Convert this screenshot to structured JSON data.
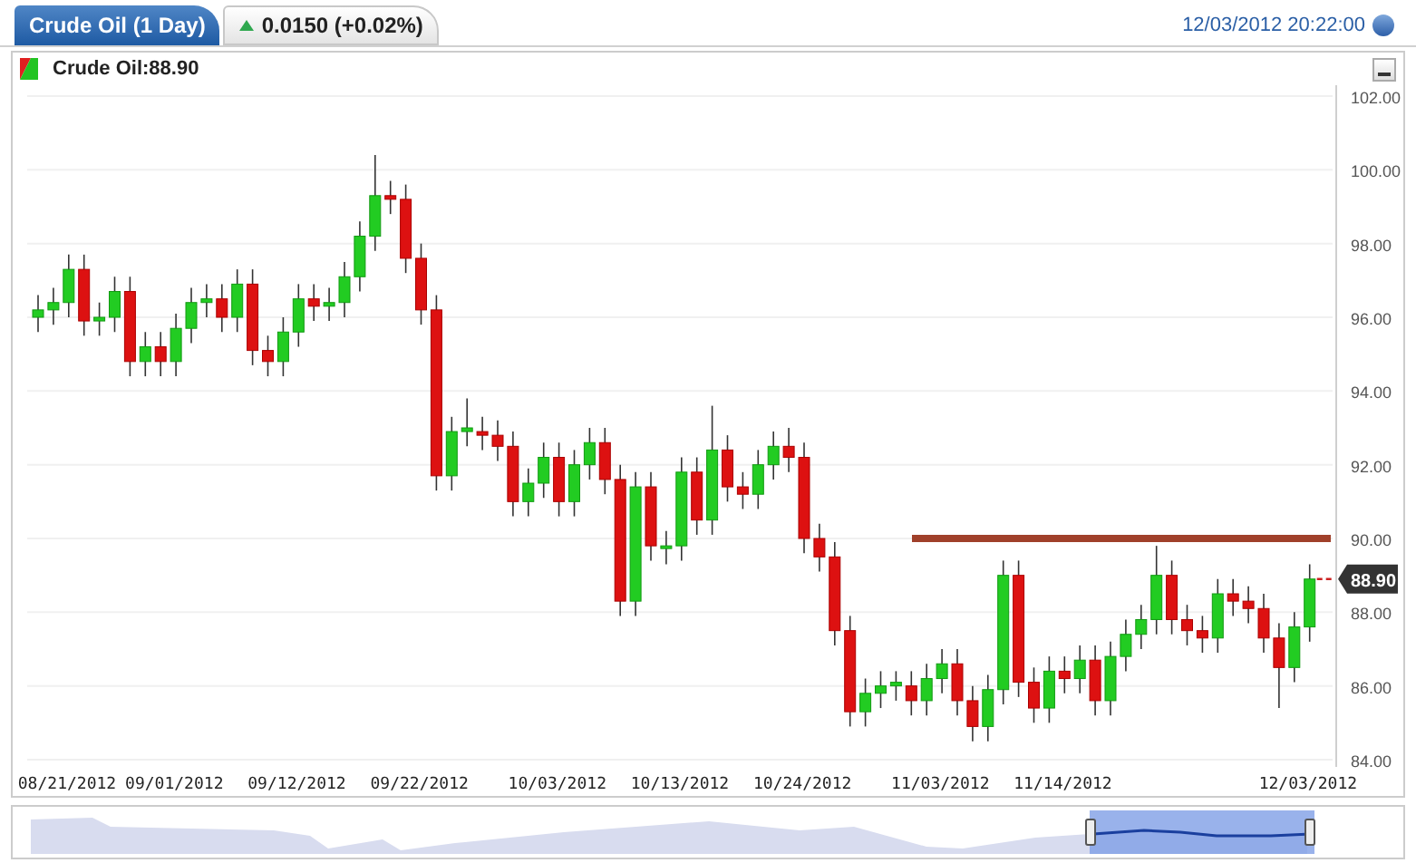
{
  "header": {
    "tabs": [
      {
        "label": "Crude Oil (1 Day)",
        "selected": true
      },
      {
        "label": "0.0150 (+0.02%)",
        "selected": false,
        "kind": "up"
      }
    ],
    "timestamp": "12/03/2012 20:22:00"
  },
  "chart": {
    "legend": "Crude Oil:88.90",
    "last_price_label": "88.90",
    "chart_data": {
      "type": "candlestick",
      "ylim": [
        84,
        102
      ],
      "categories": [
        null,
        null,
        "08/21/2012",
        null,
        null,
        null,
        null,
        null,
        null,
        "09/01/2012",
        null,
        null,
        null,
        null,
        null,
        null,
        null,
        "09/12/2012",
        null,
        null,
        null,
        null,
        null,
        null,
        null,
        "09/22/2012",
        null,
        null,
        null,
        null,
        null,
        null,
        null,
        null,
        "10/03/2012",
        null,
        null,
        null,
        null,
        null,
        null,
        null,
        "10/13/2012",
        null,
        null,
        null,
        null,
        null,
        null,
        null,
        "10/24/2012",
        null,
        null,
        null,
        null,
        null,
        null,
        null,
        null,
        "11/03/2012",
        null,
        null,
        null,
        null,
        null,
        null,
        null,
        "11/14/2012",
        null,
        null,
        null,
        null,
        null,
        null,
        null,
        null,
        null,
        null,
        null,
        null,
        null,
        null,
        null,
        "12/03/2012"
      ],
      "yticks": [
        {
          "value": 84,
          "label": "84.00"
        },
        {
          "value": 86,
          "label": "86.00"
        },
        {
          "value": 88,
          "label": "88.00"
        },
        {
          "value": 90,
          "label": "90.00"
        },
        {
          "value": 92,
          "label": "92.00"
        },
        {
          "value": 94,
          "label": "94.00"
        },
        {
          "value": 96,
          "label": "96.00"
        },
        {
          "value": 98,
          "label": "98.00"
        },
        {
          "value": 100,
          "label": "100.00"
        },
        {
          "value": 102,
          "label": "102.00"
        }
      ],
      "ohlc": [
        [
          96.0,
          96.6,
          95.6,
          96.2
        ],
        [
          96.2,
          96.8,
          95.8,
          96.4
        ],
        [
          96.4,
          97.7,
          96.0,
          97.3
        ],
        [
          97.3,
          97.7,
          95.5,
          95.9
        ],
        [
          95.9,
          96.4,
          95.5,
          96.0
        ],
        [
          96.0,
          97.1,
          95.6,
          96.7
        ],
        [
          96.7,
          97.1,
          94.4,
          94.8
        ],
        [
          94.8,
          95.6,
          94.4,
          95.2
        ],
        [
          95.2,
          95.6,
          94.4,
          94.8
        ],
        [
          94.8,
          96.1,
          94.4,
          95.7
        ],
        [
          95.7,
          96.8,
          95.3,
          96.4
        ],
        [
          96.4,
          96.9,
          96.0,
          96.5
        ],
        [
          96.5,
          96.9,
          95.6,
          96.0
        ],
        [
          96.0,
          97.3,
          95.6,
          96.9
        ],
        [
          96.9,
          97.3,
          94.7,
          95.1
        ],
        [
          95.1,
          95.5,
          94.4,
          94.8
        ],
        [
          94.8,
          96.0,
          94.4,
          95.6
        ],
        [
          95.6,
          96.9,
          95.2,
          96.5
        ],
        [
          96.5,
          96.9,
          95.9,
          96.3
        ],
        [
          96.3,
          96.8,
          95.9,
          96.4
        ],
        [
          96.4,
          97.5,
          96.0,
          97.1
        ],
        [
          97.1,
          98.6,
          96.7,
          98.2
        ],
        [
          98.2,
          100.4,
          97.8,
          99.3
        ],
        [
          99.3,
          99.7,
          98.8,
          99.2
        ],
        [
          99.2,
          99.6,
          97.2,
          97.6
        ],
        [
          97.6,
          98.0,
          95.8,
          96.2
        ],
        [
          96.2,
          96.6,
          91.3,
          91.7
        ],
        [
          91.7,
          93.3,
          91.3,
          92.9
        ],
        [
          92.9,
          93.8,
          92.5,
          93.0
        ],
        [
          92.9,
          93.3,
          92.4,
          92.8
        ],
        [
          92.8,
          93.2,
          92.1,
          92.5
        ],
        [
          92.5,
          92.9,
          90.6,
          91.0
        ],
        [
          91.0,
          91.9,
          90.6,
          91.5
        ],
        [
          91.5,
          92.6,
          91.1,
          92.2
        ],
        [
          92.2,
          92.6,
          90.6,
          91.0
        ],
        [
          91.0,
          92.4,
          90.6,
          92.0
        ],
        [
          92.0,
          93.0,
          91.6,
          92.6
        ],
        [
          92.6,
          93.0,
          91.2,
          91.6
        ],
        [
          91.6,
          92.0,
          87.9,
          88.3
        ],
        [
          88.3,
          91.8,
          87.9,
          91.4
        ],
        [
          91.4,
          91.8,
          89.4,
          89.8
        ],
        [
          89.8,
          90.2,
          89.3,
          89.8
        ],
        [
          89.8,
          92.2,
          89.4,
          91.8
        ],
        [
          91.8,
          92.2,
          90.1,
          90.5
        ],
        [
          90.5,
          93.6,
          90.1,
          92.4
        ],
        [
          92.4,
          92.8,
          91.0,
          91.4
        ],
        [
          91.4,
          91.8,
          90.8,
          91.2
        ],
        [
          91.2,
          92.4,
          90.8,
          92.0
        ],
        [
          92.0,
          92.9,
          91.6,
          92.5
        ],
        [
          92.5,
          93.0,
          91.8,
          92.2
        ],
        [
          92.2,
          92.6,
          89.6,
          90.0
        ],
        [
          90.0,
          90.4,
          89.1,
          89.5
        ],
        [
          89.5,
          89.9,
          87.1,
          87.5
        ],
        [
          87.5,
          87.9,
          84.9,
          85.3
        ],
        [
          85.3,
          86.2,
          84.9,
          85.8
        ],
        [
          85.8,
          86.4,
          85.4,
          86.0
        ],
        [
          86.0,
          86.4,
          85.6,
          86.1
        ],
        [
          86.0,
          86.4,
          85.2,
          85.6
        ],
        [
          85.6,
          86.6,
          85.2,
          86.2
        ],
        [
          86.2,
          87.0,
          85.8,
          86.6
        ],
        [
          86.6,
          87.0,
          85.2,
          85.6
        ],
        [
          85.6,
          86.0,
          84.5,
          84.9
        ],
        [
          84.9,
          86.3,
          84.5,
          85.9
        ],
        [
          85.9,
          89.4,
          85.5,
          89.0
        ],
        [
          89.0,
          89.4,
          85.7,
          86.1
        ],
        [
          86.1,
          86.5,
          85.0,
          85.4
        ],
        [
          85.4,
          86.8,
          85.0,
          86.4
        ],
        [
          86.4,
          86.8,
          85.8,
          86.2
        ],
        [
          86.2,
          87.1,
          85.8,
          86.7
        ],
        [
          86.7,
          87.1,
          85.2,
          85.6
        ],
        [
          85.6,
          87.2,
          85.2,
          86.8
        ],
        [
          86.8,
          87.8,
          86.4,
          87.4
        ],
        [
          87.4,
          88.2,
          87.0,
          87.8
        ],
        [
          87.8,
          89.8,
          87.4,
          89.0
        ],
        [
          89.0,
          89.4,
          87.4,
          87.8
        ],
        [
          87.8,
          88.2,
          87.1,
          87.5
        ],
        [
          87.5,
          87.9,
          86.9,
          87.3
        ],
        [
          87.3,
          88.9,
          86.9,
          88.5
        ],
        [
          88.5,
          88.9,
          87.9,
          88.3
        ],
        [
          88.3,
          88.7,
          87.7,
          88.1
        ],
        [
          88.1,
          88.5,
          86.9,
          87.3
        ],
        [
          87.3,
          87.7,
          85.4,
          86.5
        ],
        [
          86.5,
          88.0,
          86.1,
          87.6
        ],
        [
          87.6,
          89.3,
          87.2,
          88.9
        ]
      ],
      "grid": true,
      "ref_lines": [
        {
          "axis": "y",
          "value": 90.0,
          "color": "#a0402a"
        }
      ]
    }
  }
}
